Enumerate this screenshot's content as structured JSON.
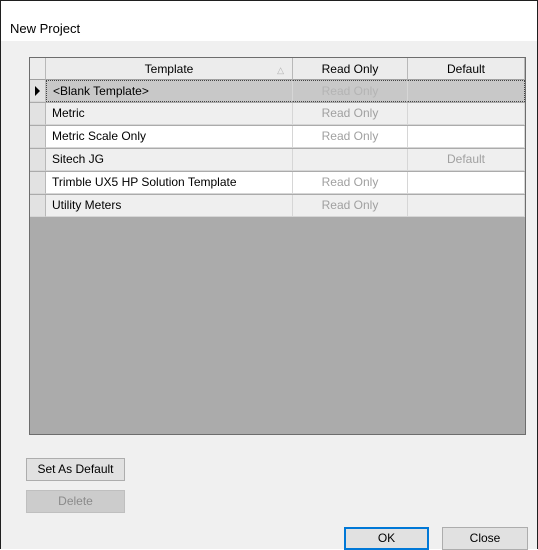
{
  "window": {
    "title": "New Project"
  },
  "grid": {
    "columns": [
      "Template",
      "Read Only",
      "Default"
    ],
    "rows": [
      {
        "template": "<Blank Template>",
        "read_only": "Read Only",
        "default": ""
      },
      {
        "template": "Metric",
        "read_only": "Read Only",
        "default": ""
      },
      {
        "template": "Metric Scale Only",
        "read_only": "Read Only",
        "default": ""
      },
      {
        "template": "Sitech JG",
        "read_only": "",
        "default": "Default"
      },
      {
        "template": "Trimble UX5 HP Solution Template",
        "read_only": "Read Only",
        "default": ""
      },
      {
        "template": "Utility Meters",
        "read_only": "Read Only",
        "default": ""
      }
    ]
  },
  "buttons": {
    "set_default": "Set As Default",
    "delete": "Delete",
    "ok": "OK",
    "close": "Close"
  },
  "icons": {
    "sort": "sort-up-icon",
    "row_pointer": "row-pointer-icon"
  },
  "colors": {
    "grid_background": "#ababab",
    "focus_border": "#0078d7"
  }
}
